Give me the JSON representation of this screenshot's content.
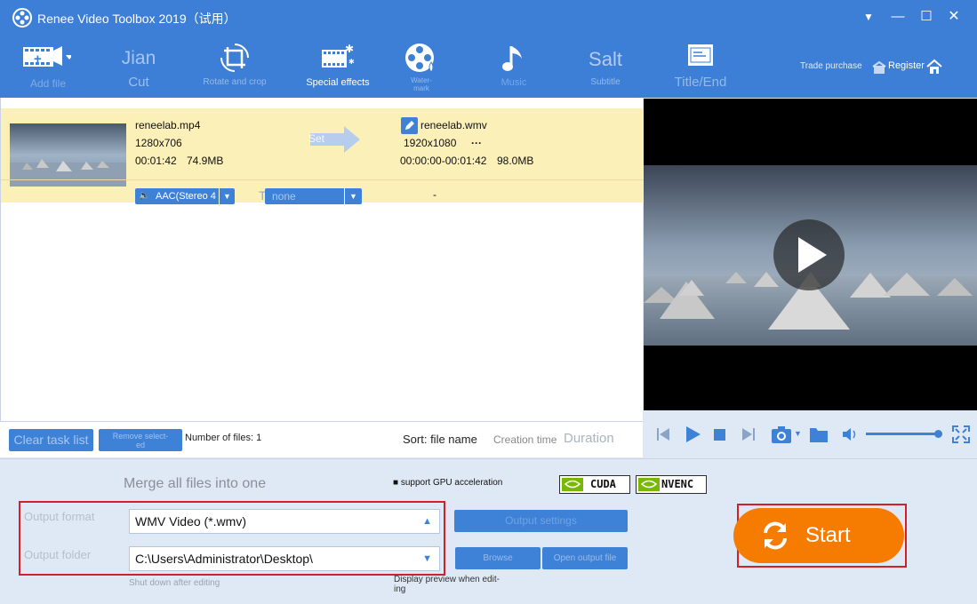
{
  "app": {
    "title": "Renee Video Toolbox 2019（试用）"
  },
  "toolbar": {
    "tools": [
      {
        "label": "Add file",
        "icon": "film-add-icon"
      },
      {
        "big": "Jian",
        "label": "Cut"
      },
      {
        "label": "Rotate and crop",
        "icon": "rotate-crop-icon"
      },
      {
        "label": "Special effects",
        "icon": "film-sparkle-icon"
      },
      {
        "label": "Water-\nmark",
        "icon": "film-reel-icon"
      },
      {
        "label": "Music",
        "icon": "music-note-icon"
      },
      {
        "big": "Salt",
        "label": "Subtitle"
      },
      {
        "label": "Title/End",
        "icon": "title-end-icon"
      }
    ],
    "trade_purchase": "Trade purchase",
    "register": "Register"
  },
  "file": {
    "source_name": "reneelab.mp4",
    "source_resolution": "1280x706",
    "source_duration": "00:01:42",
    "source_size": "74.9MB",
    "arrow_label": "Set",
    "output_name": "reneelab.wmv",
    "output_resolution": "1920x1080",
    "output_more": "···",
    "output_range": "00:00:00-00:01:42",
    "output_size": "98.0MB",
    "audio_track": "AAC(Stereo 4",
    "subtitle_track": "none",
    "subtitle_prefix": "T",
    "dash": "-"
  },
  "list_footer": {
    "clear_label": "Clear task list",
    "remove_label": "Remove select-\ned",
    "count_label": "Number of files: 1",
    "sort_label": "Sort: file name",
    "creation_time": "Creation time",
    "duration": "Duration"
  },
  "bottom": {
    "merge_label": "Merge all files into one",
    "gpu_label": "support GPU acceleration",
    "cuda": "CUDA",
    "nvenc": "NVENC",
    "format_label": "Output format",
    "format_value": "WMV Video (*.wmv)",
    "output_label": "Output folder",
    "output_value": "C:\\Users\\Administrator\\Desktop\\",
    "output_settings": "Output settings",
    "browse": "Browse",
    "open_output": "Open output file",
    "shutdown": "Shut down after editing",
    "display_preview": "Display preview when edit-\ning",
    "start": "Start"
  },
  "colors": {
    "accent": "#3d7fd6",
    "row_highlight": "#fcf0b9",
    "start_button": "#f57c00",
    "annotation_red": "#d0202a"
  }
}
